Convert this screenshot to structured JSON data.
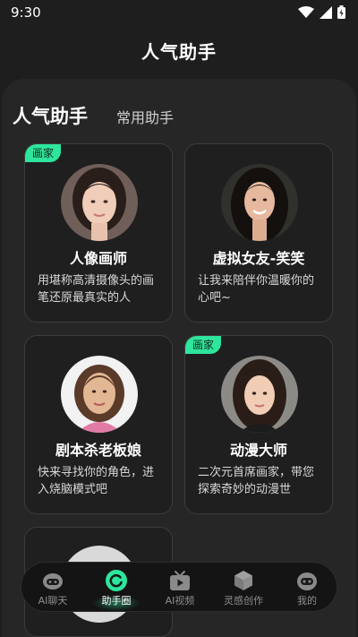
{
  "status": {
    "time": "9:30"
  },
  "app": {
    "title": "人气助手"
  },
  "tabs": [
    {
      "label": "人气助手",
      "active": true
    },
    {
      "label": "常用助手",
      "active": false
    }
  ],
  "cards": [
    {
      "badge": "画家",
      "name": "人像画师",
      "desc": "用堪称高清摄像头的画笔还原最真实的人"
    },
    {
      "badge": "",
      "name": "虚拟女友-笑笑",
      "desc": "让我来陪伴你温暖你的心吧~"
    },
    {
      "badge": "",
      "name": "剧本杀老板娘",
      "desc": "快来寻找你的角色，进入烧脑模式吧"
    },
    {
      "badge": "画家",
      "name": "动漫大师",
      "desc": "二次元首席画家，带您探索奇妙的动漫世"
    }
  ],
  "bottom_nav": [
    {
      "label": "AI聊天",
      "icon": "robot-icon",
      "active": false
    },
    {
      "label": "助手圈",
      "icon": "assistant-circle-icon",
      "active": true
    },
    {
      "label": "AI视频",
      "icon": "tv-icon",
      "active": false
    },
    {
      "label": "灵感创作",
      "icon": "cube-icon",
      "active": false
    },
    {
      "label": "我的",
      "icon": "robot-face-icon",
      "active": false
    }
  ],
  "colors": {
    "accent": "#2ee59d",
    "background": "#1e1e1e",
    "panel": "#262626",
    "card": "#1f1f1f"
  }
}
